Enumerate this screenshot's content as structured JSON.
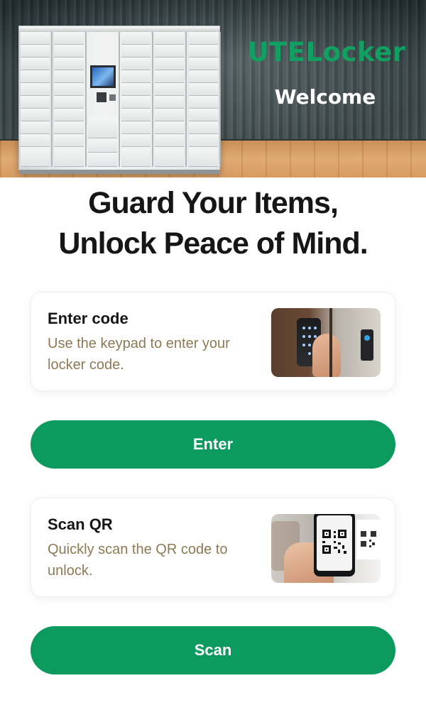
{
  "hero": {
    "brand": "UTELocker",
    "welcome": "Welcome",
    "brand_color": "#11a062"
  },
  "headline": {
    "line1": "Guard Your Items,",
    "line2": "Unlock Peace of Mind."
  },
  "cards": {
    "code": {
      "title": "Enter code",
      "description": "Use the keypad to enter your locker code.",
      "image_icon": "keypad-photo"
    },
    "qr": {
      "title": "Scan QR",
      "description": "Quickly scan the QR code to unlock.",
      "image_icon": "qr-scan-photo"
    }
  },
  "buttons": {
    "enter_label": "Enter",
    "scan_label": "Scan",
    "color": "#0c9a5f"
  },
  "colors": {
    "description_text": "#8d7a55",
    "headline_text": "#161616"
  }
}
